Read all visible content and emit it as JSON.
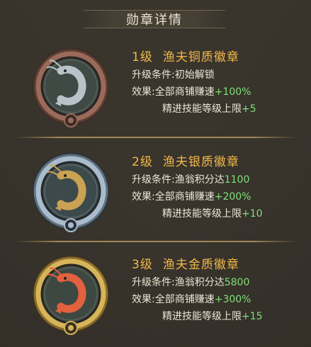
{
  "panel": {
    "title": "勋章详情"
  },
  "badges": [
    {
      "level": "1级",
      "name": "渔夫铜质徽章",
      "condition_label": "升级条件:",
      "condition_value": "初始解锁",
      "effect_label": "效果:全部商铺赚速",
      "effect_value": "+100%",
      "skill_label": "精进技能等级上限",
      "skill_value": "+5",
      "tier": "bronze",
      "ring_color": "#9a6a5a",
      "inner_color": "#3f4a44",
      "shrimp_color": "#b8c2c8"
    },
    {
      "level": "2级",
      "name": "渔夫银质徽章",
      "condition_label": "升级条件:渔翁积分达",
      "condition_value": "1100",
      "effect_label": "效果:全部商铺赚速",
      "effect_value": "+200%",
      "skill_label": "精进技能等级上限",
      "skill_value": "+10",
      "tier": "silver",
      "ring_color": "#a9bccb",
      "inner_color": "#3d4a4c",
      "shrimp_color": "#c9a253"
    },
    {
      "level": "3级",
      "name": "渔夫金质徽章",
      "condition_label": "升级条件:渔翁积分达",
      "condition_value": "5800",
      "effect_label": "效果:全部商铺赚速",
      "effect_value": "+300%",
      "skill_label": "精进技能等级上限",
      "skill_value": "+15",
      "tier": "gold",
      "ring_color": "#d6b45a",
      "inner_color": "#3e4842",
      "shrimp_color": "#e2613e"
    }
  ],
  "colors": {
    "level_text": "#f0b84a",
    "value_green": "#7fe07a",
    "body_text": "#eee7d6"
  }
}
